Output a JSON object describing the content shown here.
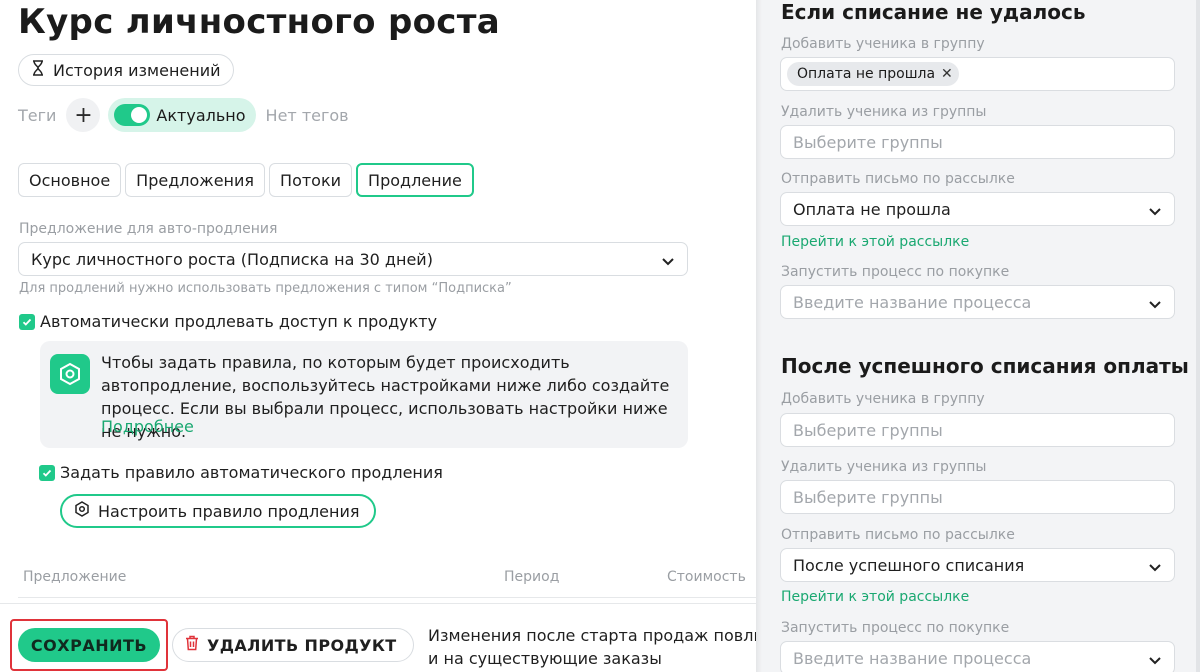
{
  "page": {
    "title": "Курс личностного роста",
    "history_label": "История изменений"
  },
  "tags": {
    "label": "Теги",
    "add_symbol": "+",
    "status_label": "Актуально",
    "empty_text": "Нет тегов"
  },
  "tabs": [
    {
      "label": "Основное",
      "active": false
    },
    {
      "label": "Предложения",
      "active": false
    },
    {
      "label": "Потоки",
      "active": false
    },
    {
      "label": "Продление",
      "active": true
    }
  ],
  "renewal": {
    "offer_label": "Предложение для авто-продления",
    "offer_value": "Курс личностного роста (Подписка на 30 дней)",
    "offer_hint": "Для продлений нужно использовать предложения с типом “Подписка”",
    "auto_renew_label": "Автоматически продлевать доступ к продукту",
    "auto_renew_checked": true,
    "info_text": "Чтобы задать правила, по которым будет происходить автопродление, воспользуйтесь настройками ниже либо создайте процесс. Если вы выбрали процесс, использовать настройки ниже не нужно.",
    "info_link": "Подробнее",
    "rule_label": "Задать правило автоматического продления",
    "rule_checked": true,
    "configure_rule_label": "Настроить правило продления"
  },
  "table": {
    "headers": [
      "Предложение",
      "Период",
      "Стоимость"
    ]
  },
  "footer": {
    "save_label": "СОХРАНИТЬ",
    "delete_label": "УДАЛИТЬ ПРОДУКТ",
    "note_line1": "Изменения после старта продаж повлия",
    "note_line2": "и на существующие заказы"
  },
  "failed_payment": {
    "title": "Если списание не удалось",
    "add_group_label": "Добавить ученика в группу",
    "add_group_chip": "Оплата не прошла",
    "remove_group_label": "Удалить ученика из группы",
    "remove_group_placeholder": "Выберите группы",
    "mailing_label": "Отправить письмо по рассылке",
    "mailing_value": "Оплата не прошла",
    "mailing_link": "Перейти к этой рассылке",
    "process_label": "Запустить процесс по покупке",
    "process_placeholder": "Введите название процесса"
  },
  "success_payment": {
    "title": "После успешного списания оплаты",
    "add_group_label": "Добавить ученика в группу",
    "add_group_placeholder": "Выберите группы",
    "remove_group_label": "Удалить ученика из группы",
    "remove_group_placeholder": "Выберите группы",
    "mailing_label": "Отправить письмо по рассылке",
    "mailing_value": "После успешного списания",
    "mailing_link": "Перейти к этой рассылке",
    "process_label": "Запустить процесс по покупке",
    "process_placeholder": "Введите название процесса"
  },
  "colors": {
    "accent": "#20c98a",
    "link": "#1aa871",
    "highlight": "#e0333a",
    "delete_icon": "#e0333a"
  }
}
